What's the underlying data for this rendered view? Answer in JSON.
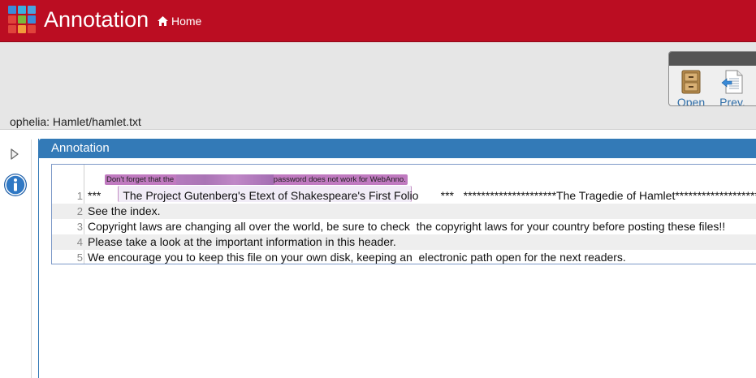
{
  "app": {
    "title": "Annotation",
    "home_label": "Home",
    "logo_colors": [
      "#3b8bd9",
      "#3bb0e0",
      "#4aa3df",
      "#e0443b",
      "#7ab93b",
      "#3b8bd9",
      "#e0443b",
      "#f19c3b",
      "#e0443b"
    ]
  },
  "toolbar": {
    "document_path": "ophelia: Hamlet/hamlet.txt",
    "open_label": "Open",
    "prev_label": "Prev."
  },
  "annotation_panel": {
    "title": "Annotation",
    "annotation_note_before": "Don't forget that the ",
    "annotation_note_after": "password does not work for WebAnno.",
    "lines": [
      {
        "number": "1",
        "text": "***       The Project Gutenberg's Etext of Shakespeare's First Folio       ***   *********************The Tragedie of Hamlet*********************"
      },
      {
        "number": "2",
        "text": "See the index."
      },
      {
        "number": "3",
        "text": "Copyright laws are changing all over the world, be sure to check  the copyright laws for your country before posting these files!!"
      },
      {
        "number": "4",
        "text": "Please take a look at the important information in this header."
      },
      {
        "number": "5",
        "text": "We encourage you to keep this file on your own disk, keeping an  electronic path open for the next readers."
      }
    ]
  },
  "colors": {
    "header_red": "#bb0d22",
    "panel_blue": "#337ab7",
    "annotation_purple": "#c07ac0"
  }
}
